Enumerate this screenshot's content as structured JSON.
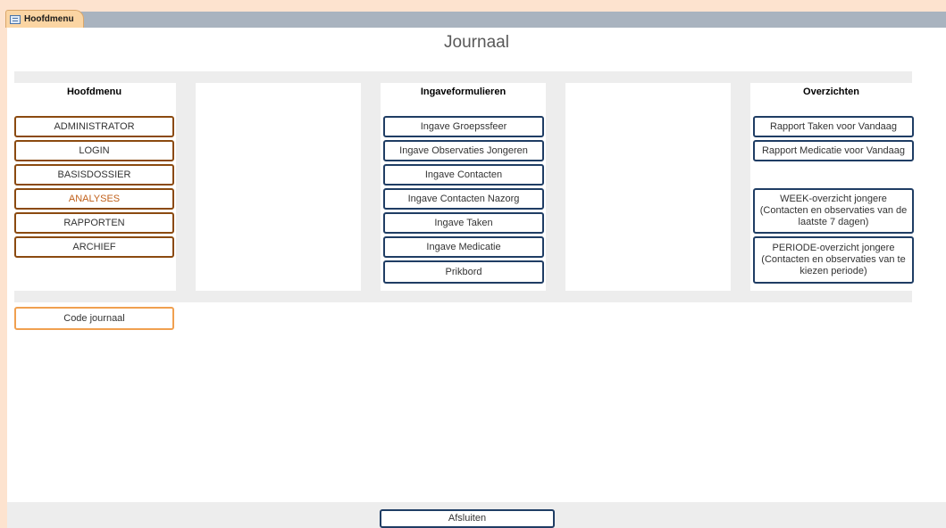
{
  "tab": {
    "label": "Hoofdmenu"
  },
  "title": "Journaal",
  "sections": {
    "hoofdmenu": "Hoofdmenu",
    "ingave": "Ingaveformulieren",
    "overzichten": "Overzichten"
  },
  "hoofdmenu_buttons": [
    "ADMINISTRATOR",
    "LOGIN",
    "BASISDOSSIER",
    "ANALYSES",
    "RAPPORTEN",
    "ARCHIEF"
  ],
  "ingave_buttons": [
    "Ingave Groepssfeer",
    "Ingave Observaties Jongeren",
    "Ingave Contacten",
    "Ingave Contacten Nazorg",
    "Ingave Taken",
    "Ingave Medicatie",
    "Prikbord"
  ],
  "overzichten_buttons": {
    "taken": "Rapport Taken voor Vandaag",
    "medicatie": "Rapport Medicatie voor Vandaag",
    "week": "WEEK-overzicht jongere (Contacten en observaties van de laatste 7 dagen)",
    "periode": "PERIODE-overzicht jongere (Contacten en observaties van te kiezen periode)"
  },
  "code_journaal": "Code journaal",
  "afsluiten": "Afsluiten",
  "colors": {
    "brown_border": "#8b4a10",
    "blue_border": "#1f3d64",
    "orange_border": "#f0a050",
    "active_text": "#c0601a",
    "background": "#fde3cf"
  }
}
